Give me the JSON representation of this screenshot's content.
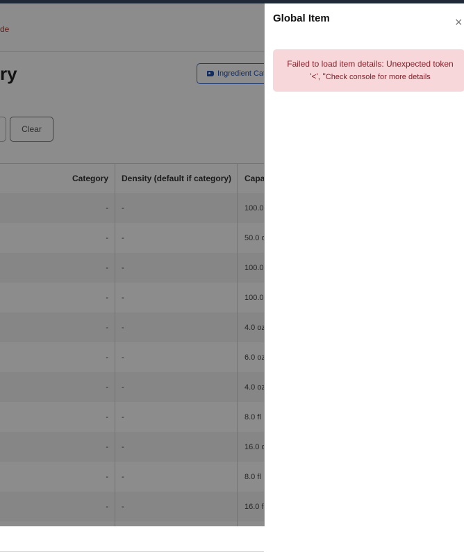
{
  "breadcrumb": "de",
  "page_title": "ry",
  "ingredient_button": "Ingredient Cat",
  "clear_button": "Clear",
  "table": {
    "headers": [
      "Category",
      "Density (default if category)",
      "Capa"
    ],
    "rows": [
      [
        "-",
        "-",
        "100.0"
      ],
      [
        "-",
        "-",
        "50.0 o"
      ],
      [
        "-",
        "-",
        "100.0"
      ],
      [
        "-",
        "-",
        "100.0"
      ],
      [
        "-",
        "-",
        "4.0 oz"
      ],
      [
        "-",
        "-",
        "6.0 oz"
      ],
      [
        "-",
        "-",
        "4.0 oz"
      ],
      [
        "-",
        "-",
        "8.0 fl"
      ],
      [
        "-",
        "-",
        "16.0 o"
      ],
      [
        "-",
        "-",
        "8.0 fl"
      ],
      [
        "-",
        "-",
        "16.0 f"
      ],
      [
        "",
        "",
        ""
      ]
    ]
  },
  "panel": {
    "title": "Global Item",
    "close_glyph": "×",
    "error_line1": "Failed to load item details: Unexpected token",
    "error_line2": "'<', \"",
    "error_line2_small": "Check console for more details"
  },
  "icons": {
    "tag": "tag-icon",
    "close": "close-icon"
  }
}
